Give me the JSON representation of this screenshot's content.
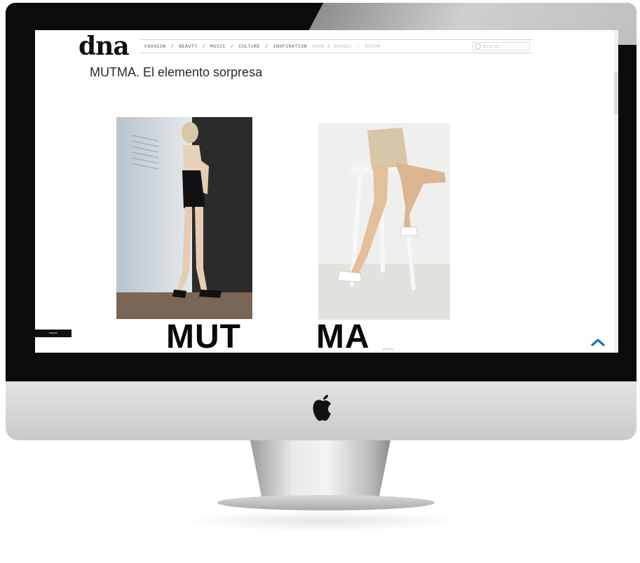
{
  "site": {
    "logo": "dna",
    "nav": [
      "FASHION",
      "/",
      "BEAUTY",
      "/",
      "MUSIC",
      "/",
      "CULTURE",
      "/",
      "INSPIRATION"
    ],
    "nav_faded": [
      "DOWN & BOUNCE",
      "/",
      "REDOM"
    ],
    "search_placeholder": "buscar"
  },
  "article": {
    "title": "MUTMA. El elemento sorpresa",
    "headline_part1": "MUT",
    "headline_part2": "MA",
    "caption": "photo by"
  },
  "colors": {
    "accent": "#1f6fc4",
    "text": "#2a2a2a",
    "bezel": "#0b0b0b"
  },
  "icons": [
    "search-icon",
    "chevron-up-icon",
    "apple-logo-icon"
  ]
}
